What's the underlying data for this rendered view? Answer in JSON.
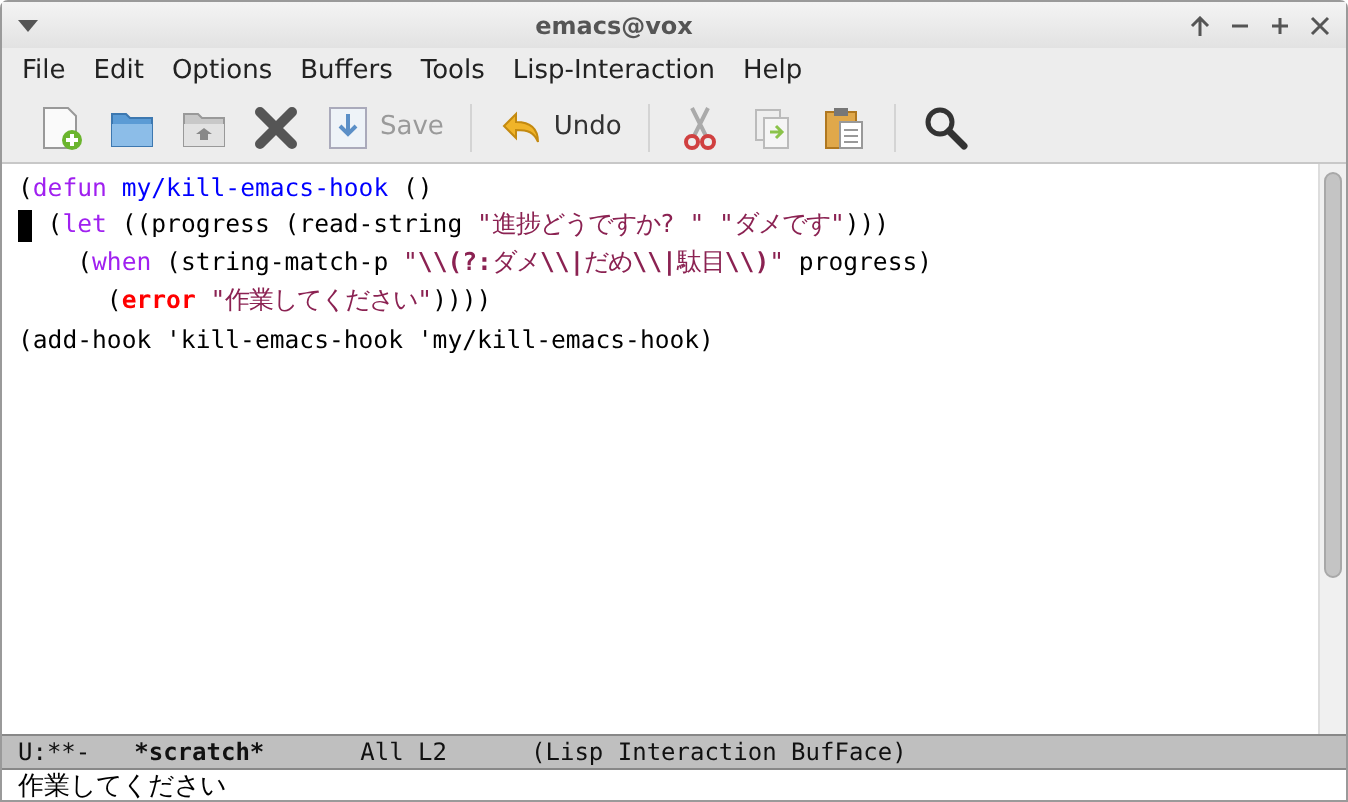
{
  "window": {
    "title": "emacs@vox"
  },
  "menu": [
    "File",
    "Edit",
    "Options",
    "Buffers",
    "Tools",
    "Lisp-Interaction",
    "Help"
  ],
  "toolbar": [
    {
      "label": "Save",
      "disabled": true
    },
    {
      "label": "Undo",
      "disabled": false
    }
  ],
  "editor": {
    "lines": [
      {
        "cursor": false,
        "tokens": [
          {
            "kind": "plain",
            "text": "("
          },
          {
            "kind": "keyword",
            "text": "defun"
          },
          {
            "kind": "function",
            "text": " my/kill-emacs-hook"
          },
          {
            "kind": "plain",
            "text": " ()"
          }
        ]
      },
      {
        "cursor": true,
        "tokens": [
          {
            "kind": "plain",
            "text": " ("
          },
          {
            "kind": "keyword",
            "text": "let"
          },
          {
            "kind": "plain",
            "text": " ((progress (read-string "
          },
          {
            "kind": "string",
            "text": "\"進捗どうですか? \""
          },
          {
            "kind": "string",
            "text": " \"ダメです\""
          },
          {
            "kind": "plain",
            "text": ")))"
          }
        ]
      },
      {
        "cursor": false,
        "tokens": [
          {
            "kind": "plain",
            "text": "    ("
          },
          {
            "kind": "keyword",
            "text": "when"
          },
          {
            "kind": "plain",
            "text": " (string-match-p "
          },
          {
            "kind": "string",
            "text": "\""
          },
          {
            "kind": "string-bold",
            "text": "\\\\(?:"
          },
          {
            "kind": "string",
            "text": "ダメ"
          },
          {
            "kind": "string-bold",
            "text": "\\\\|"
          },
          {
            "kind": "string",
            "text": "だめ"
          },
          {
            "kind": "string-bold",
            "text": "\\\\|"
          },
          {
            "kind": "string",
            "text": "駄目"
          },
          {
            "kind": "string-bold",
            "text": "\\\\)"
          },
          {
            "kind": "string",
            "text": "\""
          },
          {
            "kind": "plain",
            "text": " progress)"
          }
        ]
      },
      {
        "cursor": false,
        "tokens": [
          {
            "kind": "plain",
            "text": "      ("
          },
          {
            "kind": "warning",
            "text": "error"
          },
          {
            "kind": "string",
            "text": " \"作業してください\""
          },
          {
            "kind": "plain",
            "text": "))))"
          }
        ]
      },
      {
        "cursor": false,
        "tokens": [
          {
            "kind": "plain",
            "text": "(add-hook 'kill-emacs-hook 'my/kill-emacs-hook)"
          }
        ]
      }
    ]
  },
  "mode_line": {
    "status": "U:**-",
    "buffer": "*scratch*",
    "position": "All L2",
    "modes": "(Lisp Interaction BufFace)"
  },
  "echo_area": "作業してください"
}
